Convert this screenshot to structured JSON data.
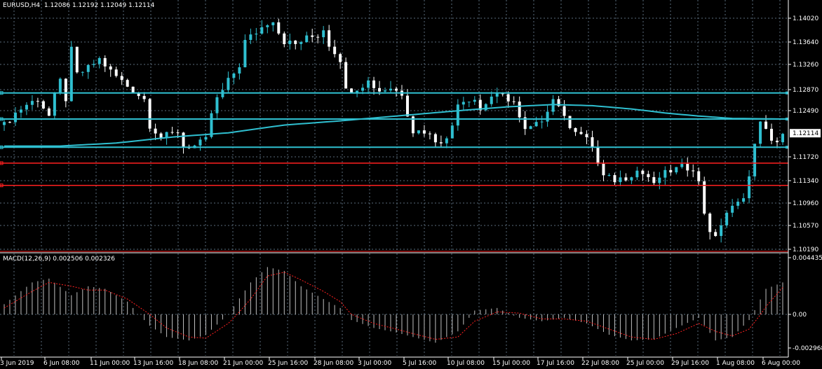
{
  "header": {
    "symbol": "EURUSD,H4",
    "open": "1.12086",
    "high": "1.12192",
    "low": "1.12049",
    "close": "1.12114"
  },
  "macd": {
    "label": "MACD(12,26,9)",
    "main_value": "0.002506",
    "signal_value": "0.002326"
  },
  "current_price_badge": "1.12114",
  "colors": {
    "background": "#000000",
    "grid": "#5a6c7c",
    "bars": "#ffffff",
    "up_candle": "#2fbfd0",
    "down_candle": "#ffffff",
    "moving_average": "#2fbfd0",
    "support_lines": "#2fbfd0",
    "red_lines": "#ff2020",
    "macd_histogram": "#c0c0c0",
    "macd_signal": "#ff2020",
    "separator": "#ff2020"
  },
  "chart_data": [
    {
      "type": "candlestick",
      "symbol": "EURUSD",
      "timeframe": "H4",
      "y_ticks": [
        "1.14020",
        "1.13640",
        "1.13260",
        "1.12870",
        "1.12490",
        "1.11720",
        "1.11340",
        "1.10960",
        "1.10570",
        "1.10190"
      ],
      "ylim": [
        1.1012,
        1.1425
      ],
      "x_ticks": [
        "3 Jun 2019",
        "6 Jun 08:00",
        "11 Jun 00:00",
        "13 Jun 16:00",
        "18 Jun 08:00",
        "21 Jun 00:00",
        "25 Jun 16:00",
        "28 Jun 08:00",
        "3 Jul 00:00",
        "5 Jul 16:00",
        "10 Jul 08:00",
        "15 Jul 00:00",
        "17 Jul 16:00",
        "22 Jul 08:00",
        "25 Jul 00:00",
        "29 Jul 16:00",
        "1 Aug 08:00",
        "6 Aug 00:00"
      ],
      "horizontal_levels": [
        {
          "color": "cyan",
          "price": 1.1281
        },
        {
          "color": "cyan",
          "price": 1.1235
        },
        {
          "color": "cyan",
          "price": 1.1188
        },
        {
          "color": "red",
          "price": 1.1162
        },
        {
          "color": "red",
          "price": 1.1126
        }
      ],
      "close_path": [
        [
          0,
          1.1225
        ],
        [
          2,
          1.1245
        ],
        [
          4,
          1.126
        ],
        [
          6,
          1.127
        ],
        [
          8,
          1.124
        ],
        [
          9,
          1.1275
        ],
        [
          10,
          1.13
        ],
        [
          11,
          1.127
        ],
        [
          12,
          1.135
        ],
        [
          13,
          1.131
        ],
        [
          15,
          1.132
        ],
        [
          17,
          1.1335
        ],
        [
          19,
          1.1315
        ],
        [
          21,
          1.13
        ],
        [
          23,
          1.1285
        ],
        [
          25,
          1.127
        ],
        [
          26,
          1.1225
        ],
        [
          28,
          1.1205
        ],
        [
          30,
          1.121
        ],
        [
          31,
          1.1215
        ],
        [
          32,
          1.119
        ],
        [
          34,
          1.119
        ],
        [
          36,
          1.12
        ],
        [
          37,
          1.1245
        ],
        [
          38,
          1.127
        ],
        [
          40,
          1.13
        ],
        [
          42,
          1.1325
        ],
        [
          43,
          1.1365
        ],
        [
          45,
          1.138
        ],
        [
          47,
          1.1395
        ],
        [
          48,
          1.14
        ],
        [
          49,
          1.138
        ],
        [
          50,
          1.1365
        ],
        [
          52,
          1.136
        ],
        [
          54,
          1.137
        ],
        [
          56,
          1.1375
        ],
        [
          57,
          1.1385
        ],
        [
          58,
          1.136
        ],
        [
          60,
          1.1335
        ],
        [
          61,
          1.1285
        ],
        [
          63,
          1.129
        ],
        [
          65,
          1.13
        ],
        [
          67,
          1.1285
        ],
        [
          69,
          1.129
        ],
        [
          71,
          1.128
        ],
        [
          72,
          1.1245
        ],
        [
          73,
          1.1215
        ],
        [
          75,
          1.1215
        ],
        [
          77,
          1.12
        ],
        [
          79,
          1.12
        ],
        [
          80,
          1.1225
        ],
        [
          81,
          1.1265
        ],
        [
          83,
          1.127
        ],
        [
          84,
          1.127
        ],
        [
          85,
          1.125
        ],
        [
          87,
          1.1275
        ],
        [
          89,
          1.1275
        ],
        [
          91,
          1.1265
        ],
        [
          92,
          1.1235
        ],
        [
          93,
          1.1215
        ],
        [
          95,
          1.1225
        ],
        [
          96,
          1.1235
        ],
        [
          98,
          1.127
        ],
        [
          99,
          1.126
        ],
        [
          100,
          1.1235
        ],
        [
          101,
          1.1225
        ],
        [
          103,
          1.121
        ],
        [
          105,
          1.119
        ],
        [
          106,
          1.116
        ],
        [
          107,
          1.114
        ],
        [
          109,
          1.1135
        ],
        [
          111,
          1.114
        ],
        [
          112,
          1.1145
        ],
        [
          113,
          1.115
        ],
        [
          115,
          1.114
        ],
        [
          116,
          1.1125
        ],
        [
          117,
          1.114
        ],
        [
          119,
          1.115
        ],
        [
          121,
          1.1155
        ],
        [
          123,
          1.1155
        ],
        [
          124,
          1.113
        ],
        [
          125,
          1.108
        ],
        [
          126,
          1.105
        ],
        [
          127,
          1.1035
        ],
        [
          128,
          1.106
        ],
        [
          129,
          1.108
        ],
        [
          131,
          1.1095
        ],
        [
          132,
          1.111
        ],
        [
          133,
          1.114
        ],
        [
          134,
          1.119
        ],
        [
          135,
          1.1235
        ],
        [
          136,
          1.1215
        ],
        [
          137,
          1.1195
        ],
        [
          138,
          1.12
        ],
        [
          139,
          1.1211
        ]
      ],
      "moving_average_path": [
        [
          0,
          1.119
        ],
        [
          10,
          1.119
        ],
        [
          20,
          1.1195
        ],
        [
          30,
          1.1205
        ],
        [
          40,
          1.1212
        ],
        [
          50,
          1.1225
        ],
        [
          60,
          1.1232
        ],
        [
          70,
          1.124
        ],
        [
          80,
          1.1248
        ],
        [
          90,
          1.1256
        ],
        [
          98,
          1.126
        ],
        [
          105,
          1.1258
        ],
        [
          112,
          1.1252
        ],
        [
          118,
          1.1245
        ],
        [
          124,
          1.124
        ],
        [
          130,
          1.1236
        ],
        [
          139,
          1.1235
        ]
      ]
    },
    {
      "type": "bar",
      "title": "MACD(12,26,9)",
      "y_ticks": [
        "0.004435",
        "0.00",
        "-0.002968"
      ],
      "ylim": [
        -0.0033,
        0.0048
      ],
      "histogram_path": [
        [
          0,
          0.0008
        ],
        [
          5,
          0.0025
        ],
        [
          8,
          0.0028
        ],
        [
          12,
          0.0015
        ],
        [
          15,
          0.0022
        ],
        [
          18,
          0.002
        ],
        [
          22,
          0.001
        ],
        [
          26,
          -0.001
        ],
        [
          29,
          -0.002
        ],
        [
          33,
          -0.0023
        ],
        [
          36,
          -0.0018
        ],
        [
          40,
          0.0
        ],
        [
          44,
          0.0025
        ],
        [
          47,
          0.0037
        ],
        [
          50,
          0.0034
        ],
        [
          53,
          0.0022
        ],
        [
          57,
          0.0012
        ],
        [
          60,
          0.0005
        ],
        [
          62,
          -0.0005
        ],
        [
          66,
          -0.0012
        ],
        [
          70,
          -0.0016
        ],
        [
          73,
          -0.002
        ],
        [
          77,
          -0.0025
        ],
        [
          81,
          -0.0015
        ],
        [
          84,
          0.0003
        ],
        [
          88,
          0.0005
        ],
        [
          92,
          -0.0003
        ],
        [
          96,
          -0.0006
        ],
        [
          100,
          -0.0003
        ],
        [
          104,
          -0.0008
        ],
        [
          108,
          -0.0018
        ],
        [
          112,
          -0.0023
        ],
        [
          116,
          -0.0022
        ],
        [
          120,
          -0.0012
        ],
        [
          124,
          -0.0003
        ],
        [
          127,
          -0.0023
        ],
        [
          130,
          -0.002
        ],
        [
          133,
          -0.0005
        ],
        [
          136,
          0.002
        ],
        [
          139,
          0.0025
        ]
      ],
      "signal_path": [
        [
          0,
          0.0005
        ],
        [
          5,
          0.0018
        ],
        [
          8,
          0.0025
        ],
        [
          12,
          0.0022
        ],
        [
          15,
          0.0019
        ],
        [
          18,
          0.0019
        ],
        [
          22,
          0.0012
        ],
        [
          26,
          0.0
        ],
        [
          29,
          -0.0012
        ],
        [
          33,
          -0.002
        ],
        [
          36,
          -0.0021
        ],
        [
          40,
          -0.0008
        ],
        [
          44,
          0.0012
        ],
        [
          47,
          0.003
        ],
        [
          50,
          0.0033
        ],
        [
          53,
          0.0027
        ],
        [
          57,
          0.0018
        ],
        [
          60,
          0.001
        ],
        [
          62,
          0.0
        ],
        [
          66,
          -0.0008
        ],
        [
          70,
          -0.0013
        ],
        [
          73,
          -0.0017
        ],
        [
          77,
          -0.0022
        ],
        [
          81,
          -0.002
        ],
        [
          84,
          -0.0006
        ],
        [
          88,
          0.0002
        ],
        [
          92,
          0.0001
        ],
        [
          96,
          -0.0004
        ],
        [
          100,
          -0.0004
        ],
        [
          104,
          -0.0006
        ],
        [
          108,
          -0.0013
        ],
        [
          112,
          -0.002
        ],
        [
          116,
          -0.0022
        ],
        [
          120,
          -0.0017
        ],
        [
          124,
          -0.0008
        ],
        [
          127,
          -0.0015
        ],
        [
          130,
          -0.0019
        ],
        [
          133,
          -0.0013
        ],
        [
          136,
          0.0006
        ],
        [
          139,
          0.0021
        ]
      ]
    }
  ]
}
